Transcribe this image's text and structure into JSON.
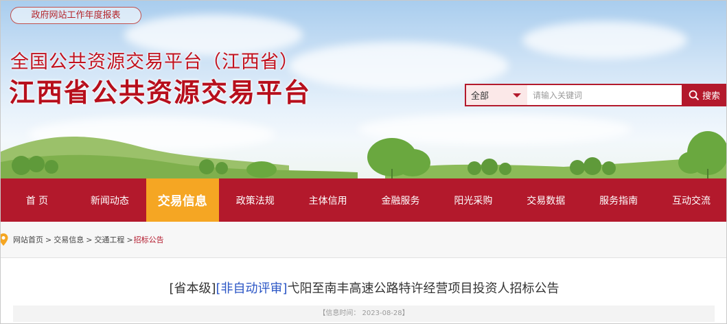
{
  "header": {
    "report_link": "政府网站工作年度报表",
    "title_line1": "全国公共资源交易平台（江西省）",
    "title_line2": "江西省公共资源交易平台"
  },
  "search": {
    "scope_selected": "全部",
    "placeholder": "请输入关键词",
    "button_label": "搜索"
  },
  "nav": {
    "items": [
      {
        "label": "首  页"
      },
      {
        "label": "新闻动态"
      },
      {
        "label": "交易信息"
      },
      {
        "label": "政策法规"
      },
      {
        "label": "主体信用"
      },
      {
        "label": "金融服务"
      },
      {
        "label": "阳光采购"
      },
      {
        "label": "交易数据"
      },
      {
        "label": "服务指南"
      },
      {
        "label": "互动交流"
      }
    ],
    "active_index": 2
  },
  "breadcrumb": {
    "items": [
      "网站首页",
      "交易信息",
      "交通工程"
    ],
    "separator": ">",
    "current": "招标公告"
  },
  "article": {
    "level_tag": "[省本级]",
    "review_tag": "[非自动评审]",
    "title": "弋阳至南丰高速公路特许经营项目投资人招标公告",
    "meta": "【信息时间： 2023-08-28】"
  },
  "colors": {
    "brand_red": "#b3192c",
    "active_orange": "#f5a623",
    "link_blue": "#2a55c5"
  }
}
